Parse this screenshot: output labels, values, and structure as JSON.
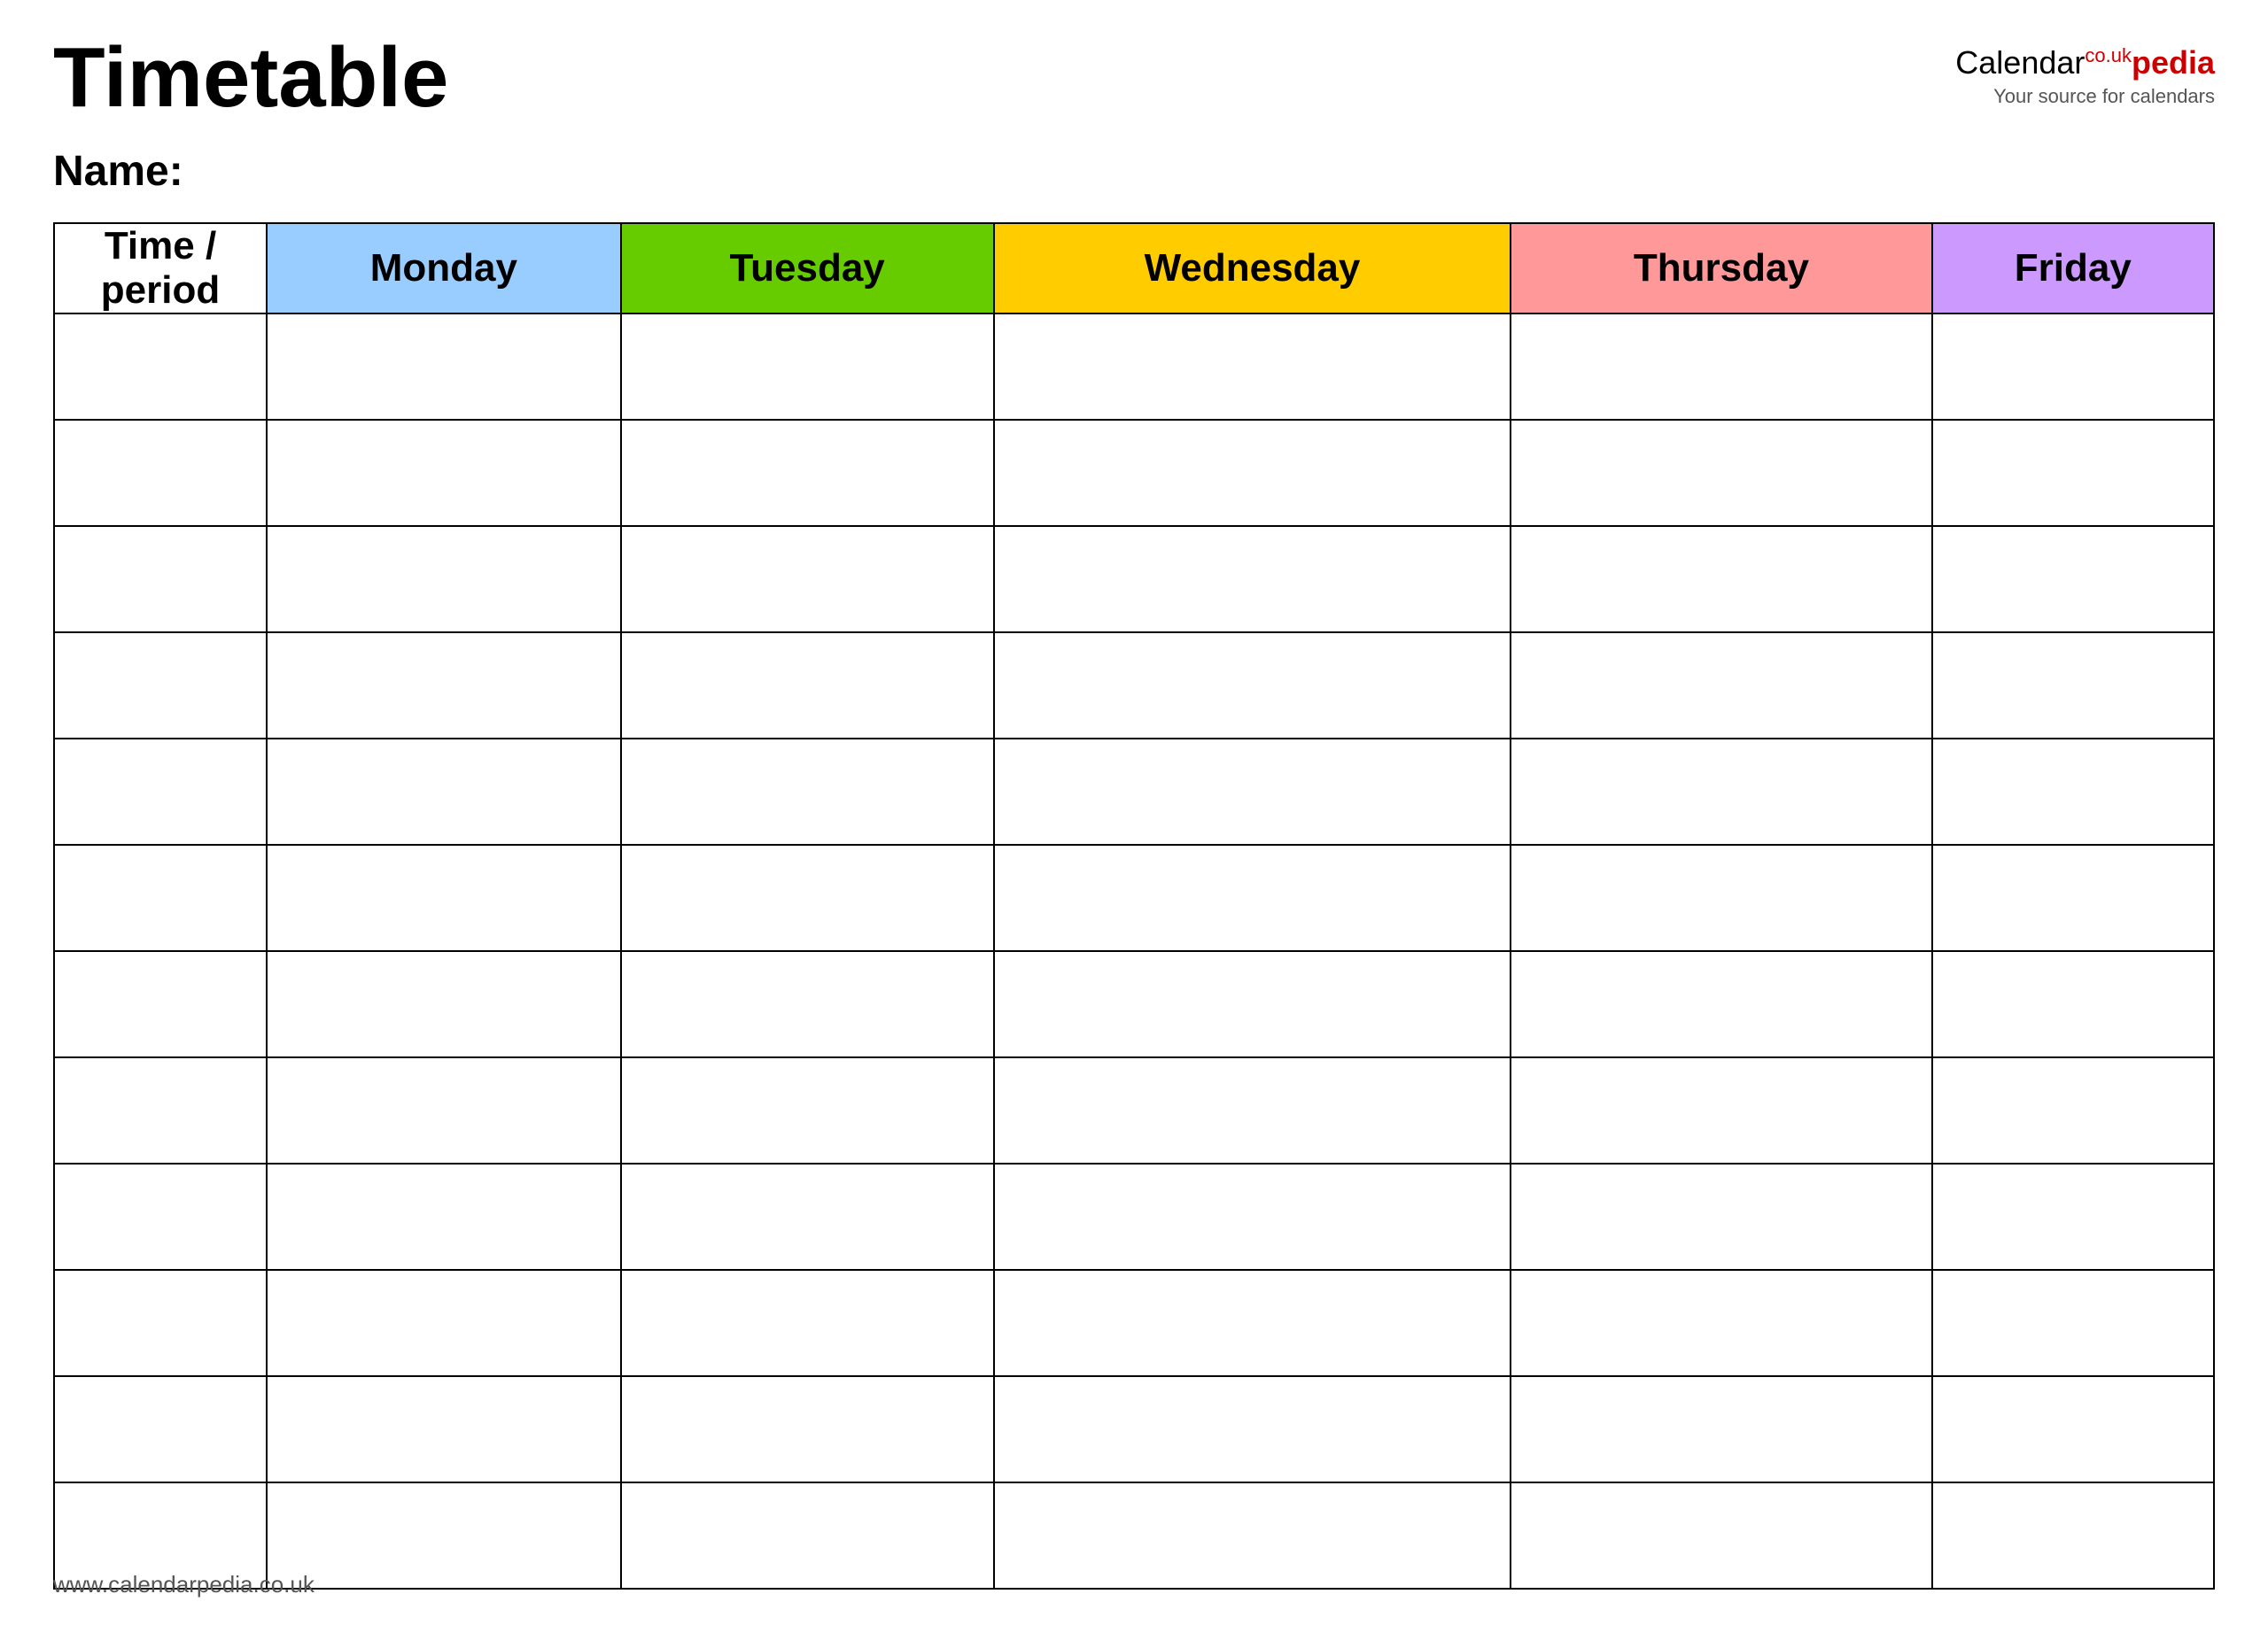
{
  "header": {
    "title": "Timetable",
    "logo": {
      "calendar": "Calendar",
      "pedia": "pedia",
      "co_uk": "co.uk",
      "subtitle": "Your source for calendars"
    }
  },
  "name_label": "Name:",
  "table": {
    "columns": [
      {
        "id": "time",
        "label": "Time / period",
        "bg": "#ffffff"
      },
      {
        "id": "monday",
        "label": "Monday",
        "bg": "#99ccff"
      },
      {
        "id": "tuesday",
        "label": "Tuesday",
        "bg": "#66cc00"
      },
      {
        "id": "wednesday",
        "label": "Wednesday",
        "bg": "#ffcc00"
      },
      {
        "id": "thursday",
        "label": "Thursday",
        "bg": "#ff9999"
      },
      {
        "id": "friday",
        "label": "Friday",
        "bg": "#cc99ff"
      }
    ],
    "row_count": 12
  },
  "footer": {
    "text": "www.calendarpedia.co.uk"
  }
}
